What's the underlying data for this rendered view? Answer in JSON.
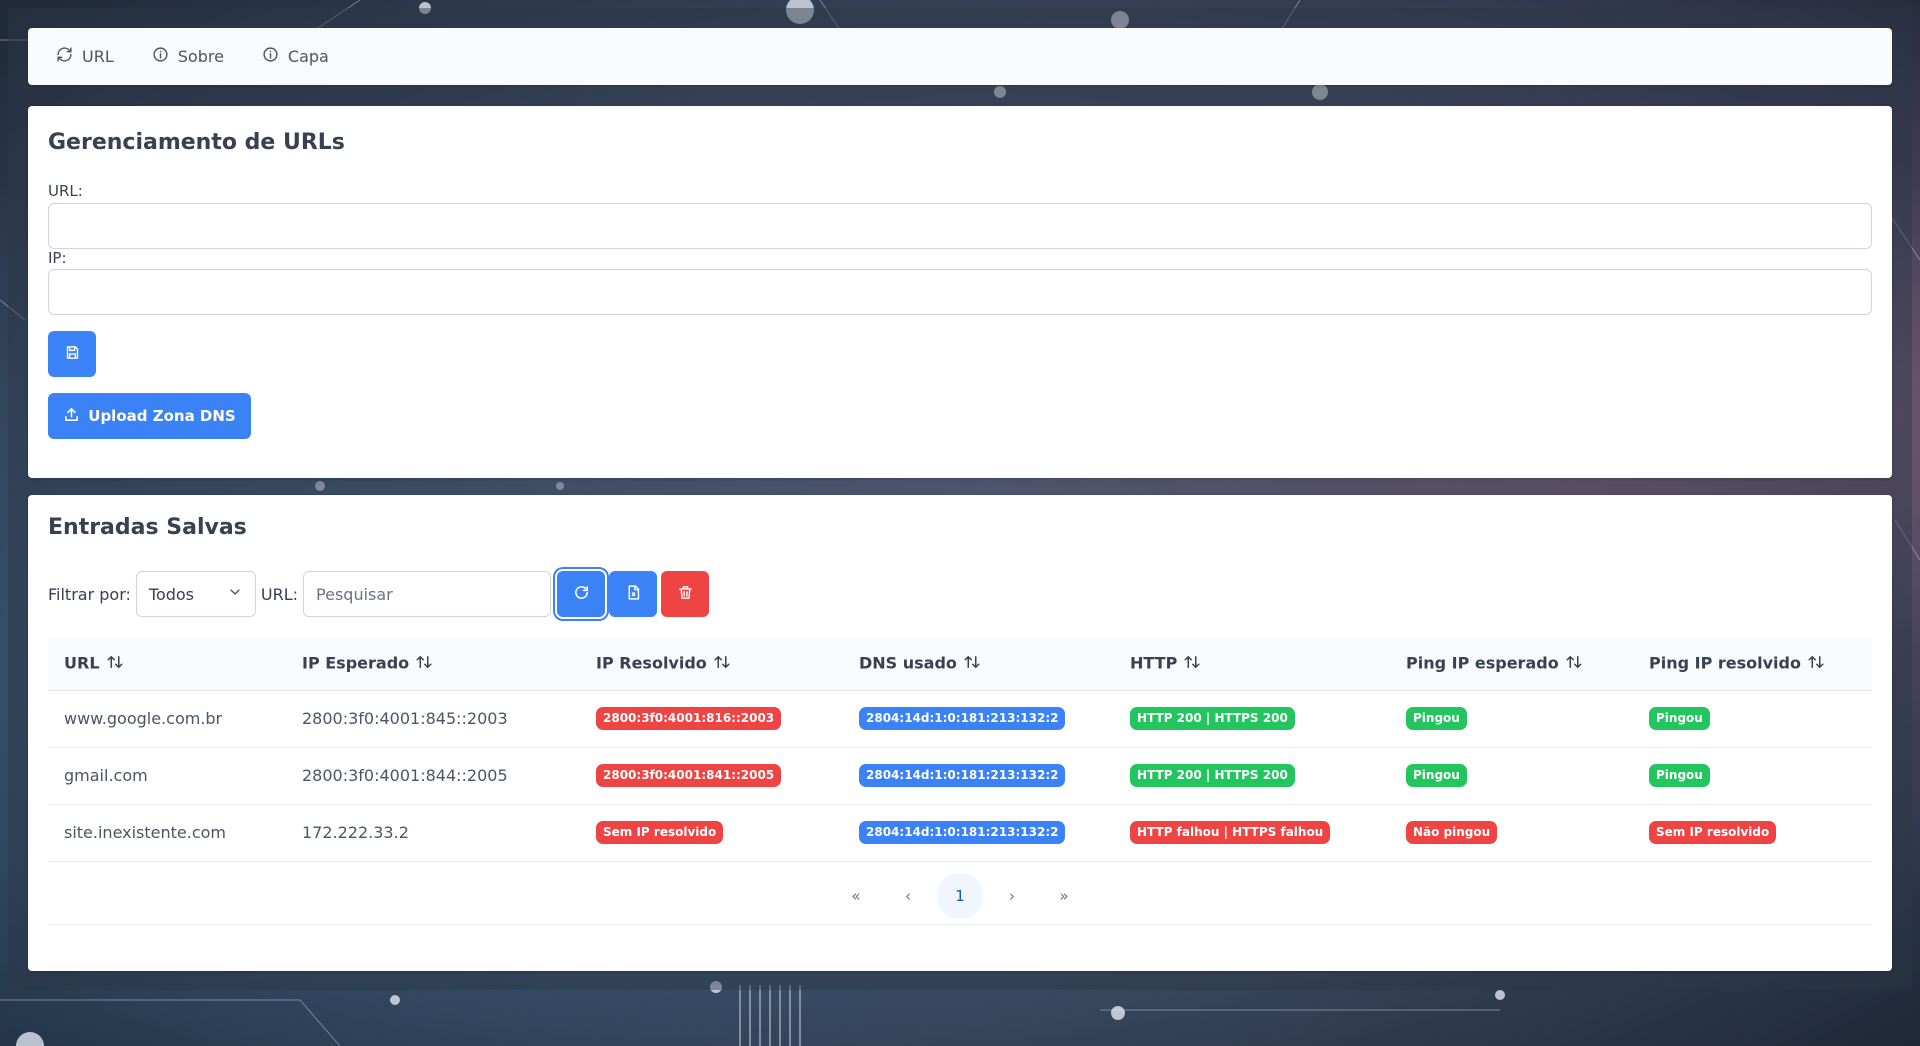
{
  "navbar": {
    "items": [
      {
        "label": "URL",
        "icon": "refresh-icon"
      },
      {
        "label": "Sobre",
        "icon": "info-icon"
      },
      {
        "label": "Capa",
        "icon": "info-icon"
      }
    ]
  },
  "management": {
    "title": "Gerenciamento de URLs",
    "url_label": "URL:",
    "ip_label": "IP:",
    "url_value": "",
    "ip_value": "",
    "save_icon": "save-icon",
    "upload_label": "Upload Zona DNS",
    "upload_icon": "upload-icon"
  },
  "entries": {
    "title": "Entradas Salvas",
    "filter_label": "Filtrar por:",
    "filter_selected": "Todos",
    "url_label": "URL:",
    "search_placeholder": "Pesquisar",
    "search_value": "",
    "columns": [
      "URL",
      "IP Esperado",
      "IP Resolvido",
      "DNS usado",
      "HTTP",
      "Ping IP esperado",
      "Ping IP resolvido"
    ],
    "rows": [
      {
        "url": "www.google.com.br",
        "ip_esperado": "2800:3f0:4001:845::2003",
        "ip_resolvido": "2800:3f0:4001:816::2003",
        "dns_usado": "2804:14d:1:0:181:213:132:2",
        "http": "HTTP 200 | HTTPS 200",
        "ping_esperado": "Pingou",
        "ping_resolvido": "Pingou"
      },
      {
        "url": "gmail.com",
        "ip_esperado": "2800:3f0:4001:844::2005",
        "ip_resolvido": "2800:3f0:4001:841::2005",
        "dns_usado": "2804:14d:1:0:181:213:132:2",
        "http": "HTTP 200 | HTTPS 200",
        "ping_esperado": "Pingou",
        "ping_resolvido": "Pingou"
      },
      {
        "url": "site.inexistente.com",
        "ip_esperado": "172.222.33.2",
        "ip_resolvido": "Sem IP resolvido",
        "dns_usado": "2804:14d:1:0:181:213:132:2",
        "http": "HTTP falhou | HTTPS falhou",
        "ping_esperado": "Não pingou",
        "ping_resolvido": "Sem IP resolvido"
      }
    ],
    "pagination": {
      "first": "«",
      "prev": "‹",
      "current": "1",
      "next": "›",
      "last": "»"
    }
  },
  "colors": {
    "primary": "#3b82f6",
    "danger": "#ef4444",
    "success": "#22c55e"
  }
}
